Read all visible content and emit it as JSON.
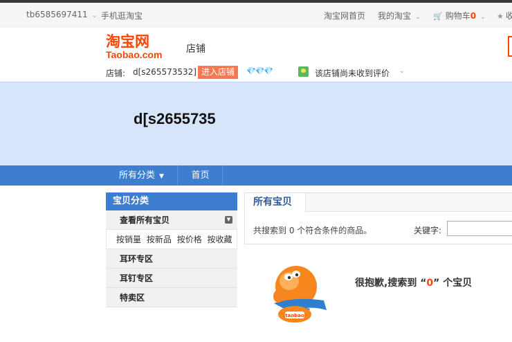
{
  "site_nav": {
    "username": "tb6585697411",
    "mobile": "手机逛淘宝",
    "home": "淘宝网首页",
    "my_taobao": "我的淘宝",
    "cart_label": "购物车",
    "cart_count": "0",
    "favorites": "收"
  },
  "header": {
    "logo_cn": "淘宝网",
    "logo_en": "Taobao.com",
    "shop_word": "店铺"
  },
  "shop_info": {
    "label": "店铺:",
    "shop_name": "d[s265573532]",
    "enter_button": "进入店铺",
    "diamonds": "💎💎💎",
    "rating_text": "该店铺尚未收到评价"
  },
  "banner": {
    "title": "d[s2655735"
  },
  "menu": {
    "all_categories": "所有分类",
    "home": "首页"
  },
  "sidebar": {
    "heading": "宝贝分类",
    "view_all": "查看所有宝贝",
    "sort_options": [
      "按销量",
      "按新品",
      "按价格",
      "按收藏"
    ],
    "categories": [
      "耳环专区",
      "耳钉专区",
      "特卖区"
    ]
  },
  "main": {
    "tab": "所有宝贝",
    "result_text": "共搜索到 0 个符合条件的商品。",
    "keyword_label": "关键字:",
    "keyword_value": "",
    "empty_prefix": "很抱歉,搜索到 “",
    "empty_count": "0",
    "empty_suffix": "” 个宝贝"
  },
  "mascot": {
    "badge": "taobao"
  },
  "colors": {
    "accent": "#ff4400",
    "menu_blue": "#3d7ed1",
    "banner_bg": "#d6e5f9"
  }
}
